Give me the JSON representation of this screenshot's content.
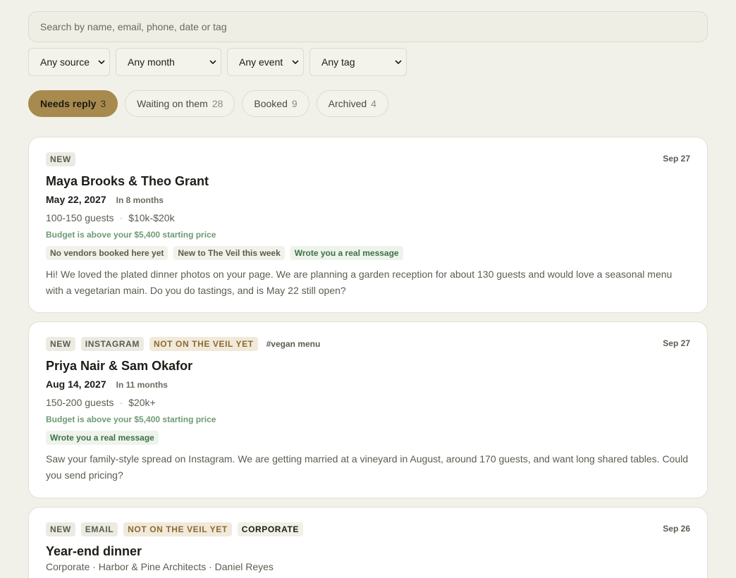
{
  "search": {
    "placeholder": "Search by name, email, phone, date or tag"
  },
  "filters": [
    "Any source",
    "Any month",
    "Any event",
    "Any tag"
  ],
  "tabs": [
    {
      "label": "Needs reply",
      "count": "3"
    },
    {
      "label": "Waiting on them",
      "count": "28"
    },
    {
      "label": "Booked",
      "count": "9"
    },
    {
      "label": "Archived",
      "count": "4"
    }
  ],
  "cards": [
    {
      "badges": [
        "NEW"
      ],
      "date": "Sep 27",
      "name": "Maya Brooks & Theo Grant",
      "wedding_date": "May 22, 2027",
      "in_months": "In 8 months",
      "guests": "100-150 guests",
      "budget": "$10k-$20k",
      "budget_note": "Budget is above your $5,400 starting price",
      "tags": [
        "No vendors booked here yet",
        "New to The Veil this week",
        "Wrote you a real message"
      ],
      "message": "Hi! We loved the plated dinner photos on your page. We are planning a garden reception for about 130 guests and would love a seasonal menu with a vegetarian main. Do you do tastings, and is May 22 still open?"
    },
    {
      "badges": [
        "NEW",
        "INSTAGRAM",
        "NOT ON THE VEIL YET"
      ],
      "hashtag": "#vegan menu",
      "date": "Sep 27",
      "name": "Priya Nair & Sam Okafor",
      "wedding_date": "Aug 14, 2027",
      "in_months": "In 11 months",
      "guests": "150-200 guests",
      "budget": "$20k+",
      "budget_note": "Budget is above your $5,400 starting price",
      "tags": [
        "Wrote you a real message"
      ],
      "message": "Saw your family-style spread on Instagram. We are getting married at a vineyard in August, around 170 guests, and want long shared tables. Could you send pricing?"
    },
    {
      "badges": [
        "NEW",
        "EMAIL",
        "NOT ON THE VEIL YET",
        "CORPORATE"
      ],
      "date": "Sep 26",
      "name": "Year-end dinner",
      "subtitle": "Corporate · Harbor & Pine Architects · Daniel Reyes"
    }
  ],
  "colors": {
    "accent": "#a88a4e",
    "background": "#f1f1e9",
    "green": "#6f9a72"
  },
  "icons": {
    "dropdown": "chevron-down-icon"
  }
}
